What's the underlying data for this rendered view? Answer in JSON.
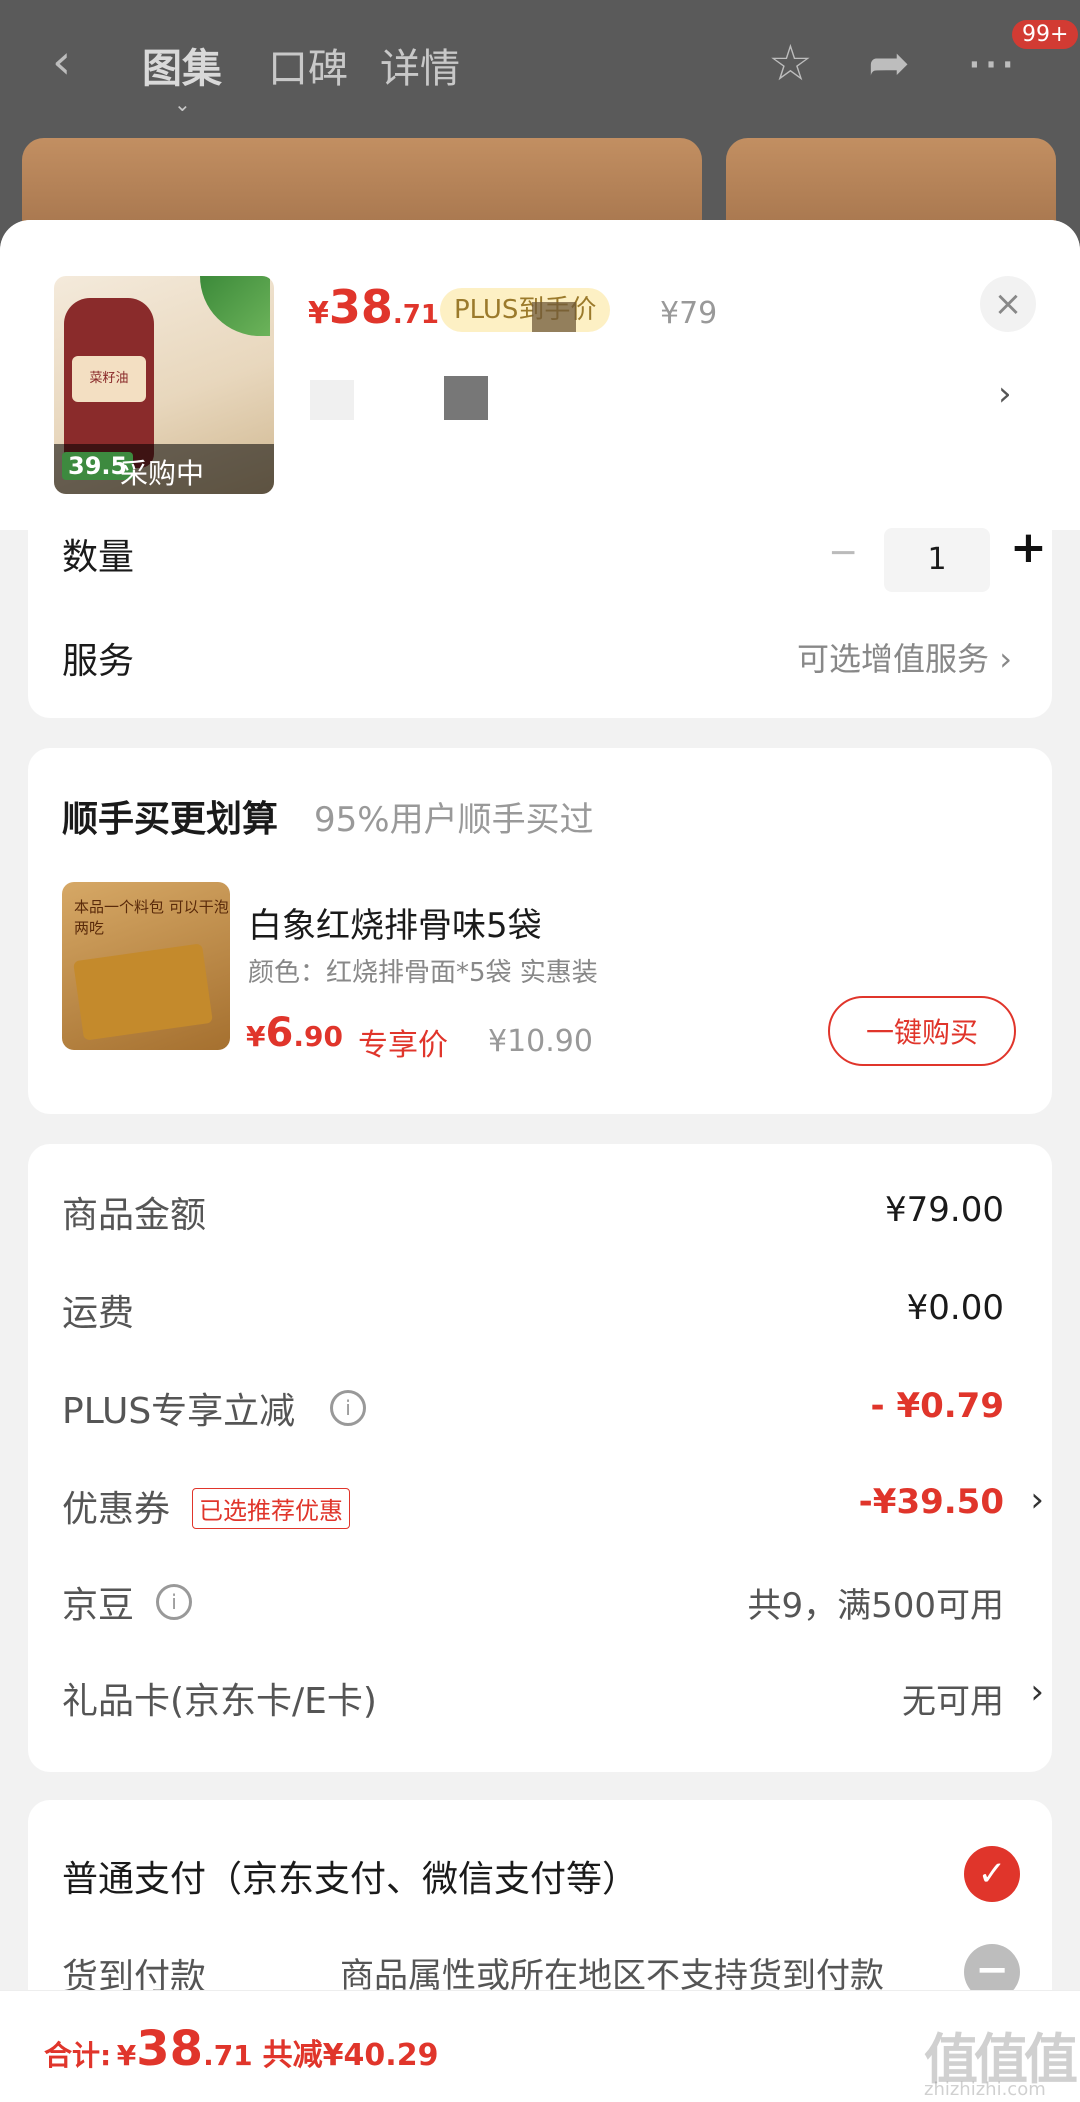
{
  "topnav": {
    "tabs": [
      "图集",
      "口碑",
      "详情"
    ],
    "badge": "99+",
    "icons": [
      "back-icon",
      "star-icon",
      "share-icon",
      "more-icon"
    ]
  },
  "product": {
    "status": "采购中",
    "thumb_price_tag": "39.5",
    "price_currency": "¥",
    "price_int": "38",
    "price_dec": ".71",
    "plus_tag": "PLUS到手价",
    "orig_price": "¥79",
    "close": "×",
    "spec_arrow": "›"
  },
  "quantity": {
    "label": "数量",
    "value": "1",
    "minus": "−",
    "plus": "+"
  },
  "service": {
    "label": "服务",
    "value": "可选增值服务",
    "arrow": "›"
  },
  "addon": {
    "title": "顺手买更划算",
    "subtitle": "95%用户顺手买过",
    "image_text": "本品一个料包 可以干泡两吃",
    "name": "白象红烧排骨味5袋",
    "spec": "颜色：红烧排骨面*5袋 实惠装",
    "price_currency": "¥",
    "price_int": "6",
    "price_dec": ".90",
    "price_tag": "专享价",
    "orig_price": "¥10.90",
    "buy_label": "一键购买"
  },
  "fees": {
    "goods_label": "商品金额",
    "goods_value": "¥79.00",
    "shipping_label": "运费",
    "shipping_value": "¥0.00",
    "plus_label": "PLUS专享立减",
    "plus_value": "- ¥0.79",
    "coupon_label": "优惠券",
    "coupon_tag": "已选推荐优惠",
    "coupon_value": "-¥39.50",
    "jingdou_label": "京豆",
    "jingdou_value": "共9，满500可用",
    "giftcard_label": "礼品卡(京东卡/E卡)",
    "giftcard_value": "无可用",
    "info": "i",
    "arrow": "›"
  },
  "payment": {
    "normal_label": "普通支付（京东支付、微信支付等）",
    "cod_label": "货到付款",
    "cod_note": "商品属性或所在地区不支持货到付款",
    "check": "✓",
    "disabled": "−"
  },
  "footer": {
    "total_label": "合计:",
    "currency": "¥",
    "total_int": "38",
    "total_dec": ".71",
    "saved": "共减¥40.29",
    "watermark": "值值值",
    "watermark_url": "zhizhizhi.com"
  },
  "colors": {
    "accent": "#e0352b",
    "plus_tag_bg": "#fdf0c4",
    "overlay": "#5a5a5a"
  }
}
